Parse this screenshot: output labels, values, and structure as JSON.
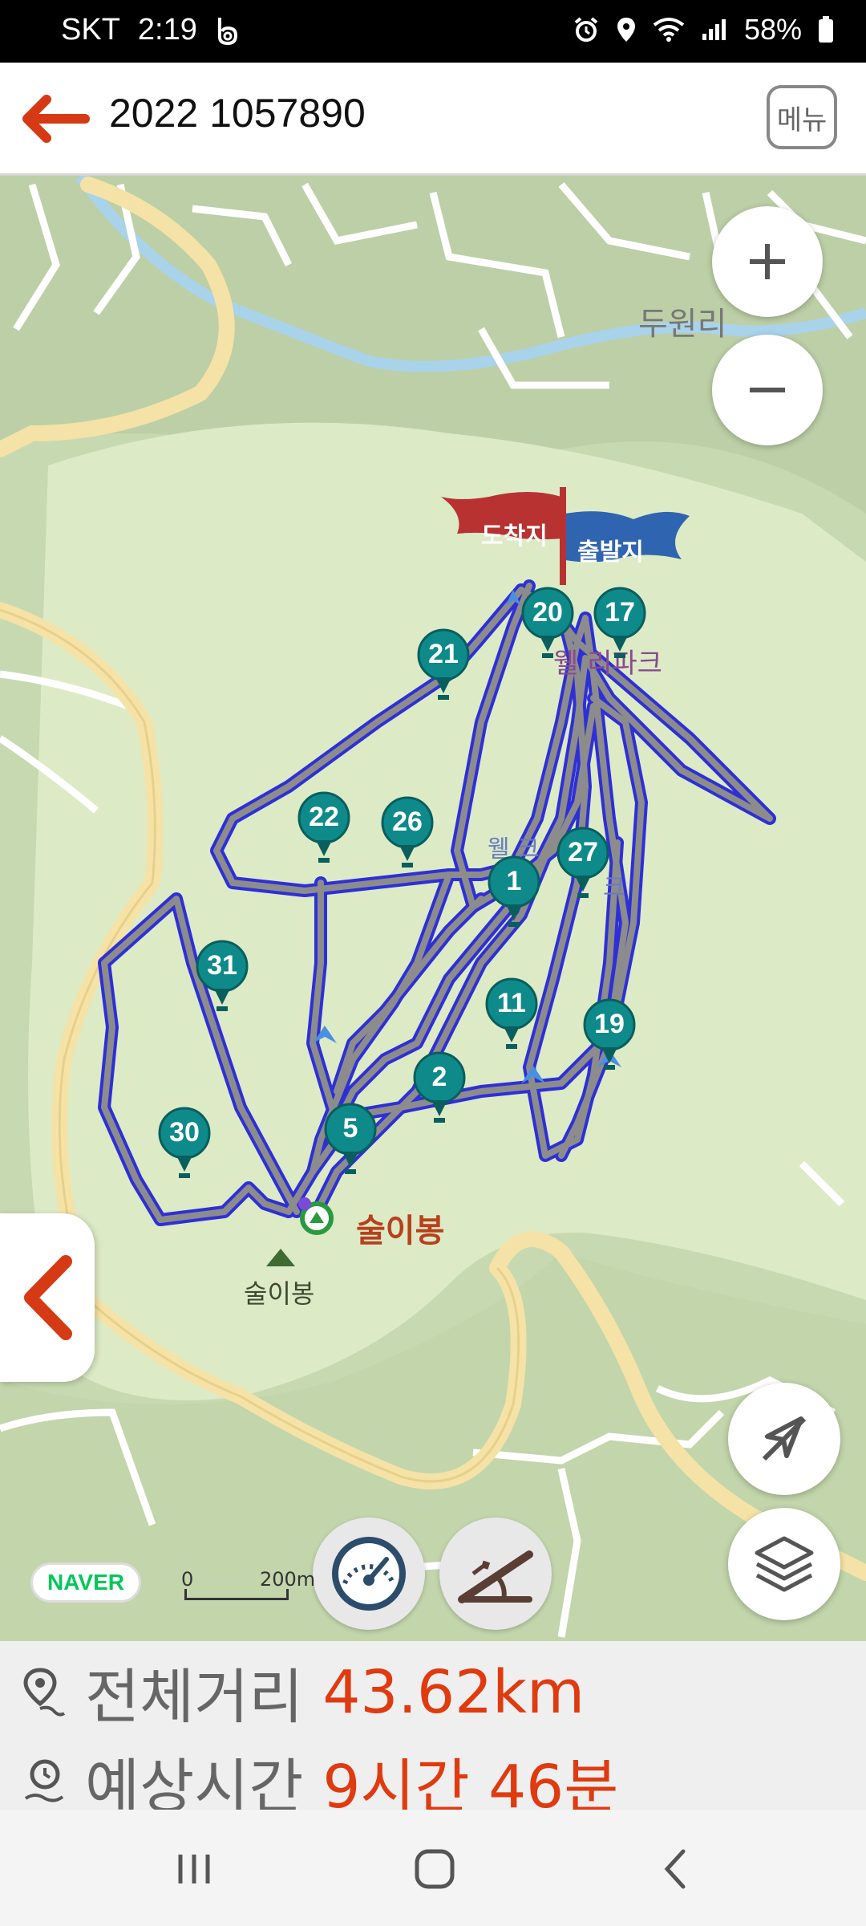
{
  "status_bar": {
    "carrier": "SKT",
    "time": "2:19",
    "battery": "58%"
  },
  "header": {
    "title": "2022 1057890",
    "menu_label": "메뉴"
  },
  "map": {
    "place_dowonri": "두원리",
    "place_suribong_label": "술이봉",
    "place_suribong_peak": "술이봉",
    "place_park1": "웰 리파크",
    "place_park2": "웰 크",
    "place_park3": "크",
    "flag_arrival": "도착지",
    "flag_departure": "출발지",
    "naver_logo": "NAVER",
    "scale_zero": "0",
    "scale_distance": "200m",
    "markers": [
      "20",
      "17",
      "21",
      "22",
      "26",
      "1",
      "27",
      "31",
      "11",
      "19",
      "2",
      "5",
      "30"
    ]
  },
  "summary": {
    "distance_label": "전체거리",
    "distance_value": "43.62km",
    "time_label": "예상시간",
    "time_value": "9시간 46분"
  },
  "colors": {
    "accent": "#e03a10",
    "route_outline": "#2f2fd8",
    "route_fill": "#8c8c8c",
    "marker": "#0f8a8a",
    "flag_arrival": "#b83232",
    "flag_departure": "#2f64b0"
  }
}
